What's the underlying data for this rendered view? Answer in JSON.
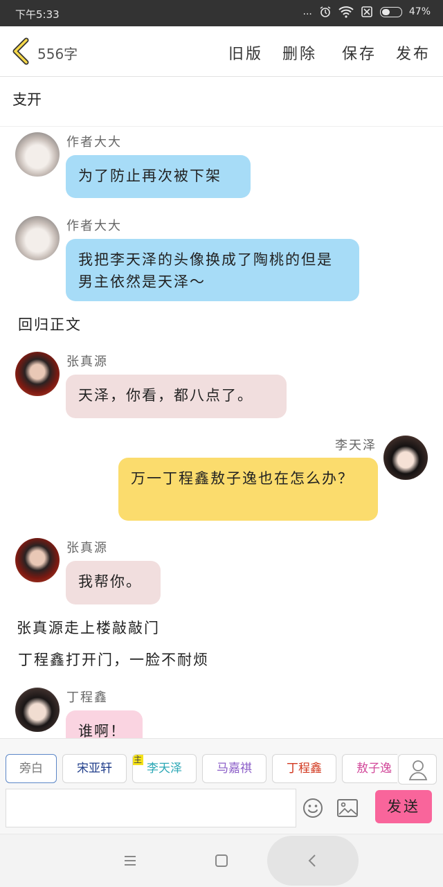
{
  "status": {
    "time": "下午5:33",
    "dots": "...",
    "battery_text": "47%",
    "battery_level": 0.47
  },
  "header": {
    "word_count": "556字",
    "actions": [
      "旧版",
      "删除",
      "保存",
      "发布"
    ]
  },
  "story": {
    "title": "支开"
  },
  "chat": {
    "m1": {
      "sender": "作者大大",
      "text": "为了防止再次被下架"
    },
    "m2": {
      "sender": "作者大大",
      "text": "我把李天泽的头像换成了陶桃的但是男主依然是天泽～"
    },
    "n1": "回归正文",
    "m3": {
      "sender": "张真源",
      "text": "天泽，你看，都八点了。"
    },
    "m4": {
      "sender": "李天泽",
      "text": "万一丁程鑫敖子逸也在怎么办？"
    },
    "m5": {
      "sender": "张真源",
      "text": "我帮你。"
    },
    "n2": "张真源走上楼敲敲门",
    "n3": "丁程鑫打开门，一脸不耐烦",
    "m6": {
      "sender": "丁程鑫",
      "text": "谁啊！"
    }
  },
  "roles": [
    {
      "label": "旁白",
      "color": "#777777"
    },
    {
      "label": "宋亚轩",
      "color": "#1f3d8a"
    },
    {
      "label": "李天泽",
      "color": "#2aa7b5",
      "tag": "主"
    },
    {
      "label": "马嘉祺",
      "color": "#8a5cc7"
    },
    {
      "label": "丁程鑫",
      "color": "#d2381f"
    },
    {
      "label": "敖子逸",
      "color": "#d2489a"
    }
  ],
  "input": {
    "value": "",
    "placeholder": ""
  },
  "send": {
    "label": "发送"
  }
}
